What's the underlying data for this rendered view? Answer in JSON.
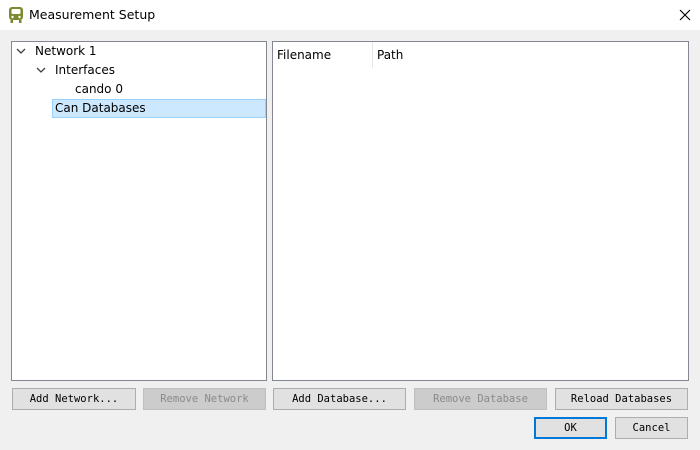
{
  "window": {
    "title": "Measurement Setup",
    "icon": "bus-icon",
    "accent_color": "#0078d7"
  },
  "tree": {
    "nodes": [
      {
        "label": "Network 1",
        "expanded": true
      },
      {
        "label": "Interfaces",
        "expanded": true
      },
      {
        "label": "cando 0"
      },
      {
        "label": "Can Databases",
        "selected": true
      }
    ]
  },
  "table": {
    "columns": [
      "Filename",
      "Path"
    ],
    "rows": []
  },
  "buttons": {
    "add_network": "Add Network...",
    "remove_network": "Remove Network",
    "add_database": "Add Database...",
    "remove_database": "Remove Database",
    "reload_databases": "Reload Databases",
    "ok": "OK",
    "cancel": "Cancel"
  }
}
